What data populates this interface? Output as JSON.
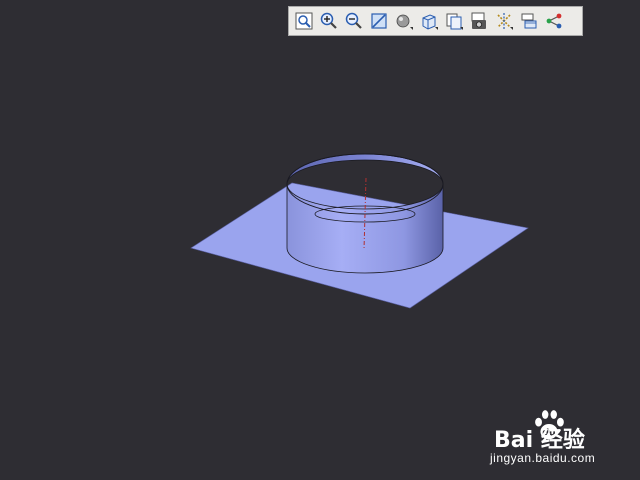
{
  "toolbar": {
    "buttons": [
      {
        "icon": "zoom-fit-icon"
      },
      {
        "icon": "zoom-in-icon"
      },
      {
        "icon": "zoom-out-icon"
      },
      {
        "icon": "zoom-window-icon"
      },
      {
        "icon": "render-mode-icon"
      },
      {
        "icon": "view-orientation-icon"
      },
      {
        "icon": "copy-view-icon"
      },
      {
        "icon": "screenshot-camera-icon"
      },
      {
        "icon": "toggle-visibility-icon"
      },
      {
        "icon": "section-view-icon"
      },
      {
        "icon": "graph-nodes-icon"
      }
    ]
  },
  "scene": {
    "model_color": "#9aa4ee",
    "background_color": "#2e2d33"
  },
  "watermark": {
    "logo_text": "Bai  经验",
    "url": "jingyan.baidu.com"
  }
}
